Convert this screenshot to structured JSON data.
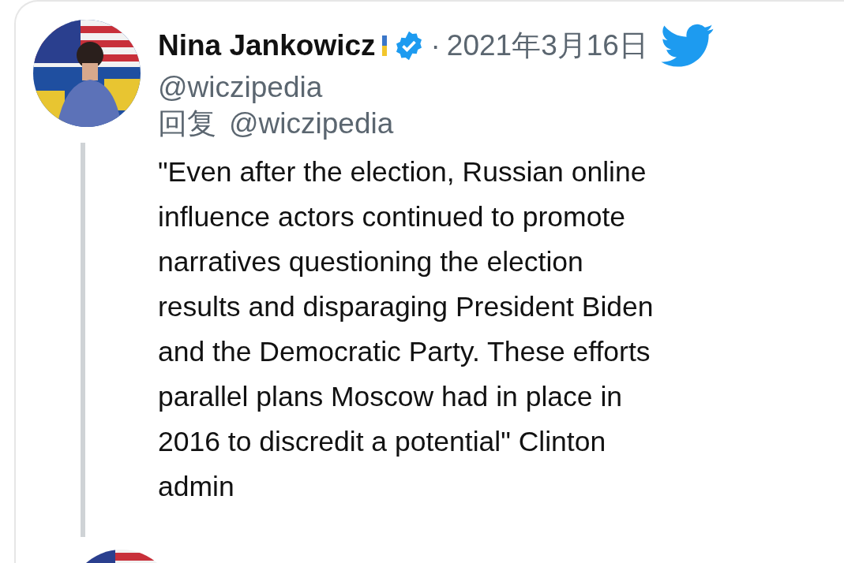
{
  "tweet": {
    "name": "Nina Jankowicz",
    "verified": true,
    "separator": "·",
    "date": "2021年3月16日",
    "handle": "@wiczipedia",
    "reply_label": "回复",
    "reply_to": "@wiczipedia",
    "text_lines": [
      "\"Even after the election, Russian online",
      "influence actors continued to promote",
      "narratives questioning the election",
      "results and disparaging President Biden",
      "and the Democratic Party. These efforts",
      "parallel plans Moscow had in place in",
      "2016 to discredit a potential\" Clinton",
      "admin"
    ]
  }
}
